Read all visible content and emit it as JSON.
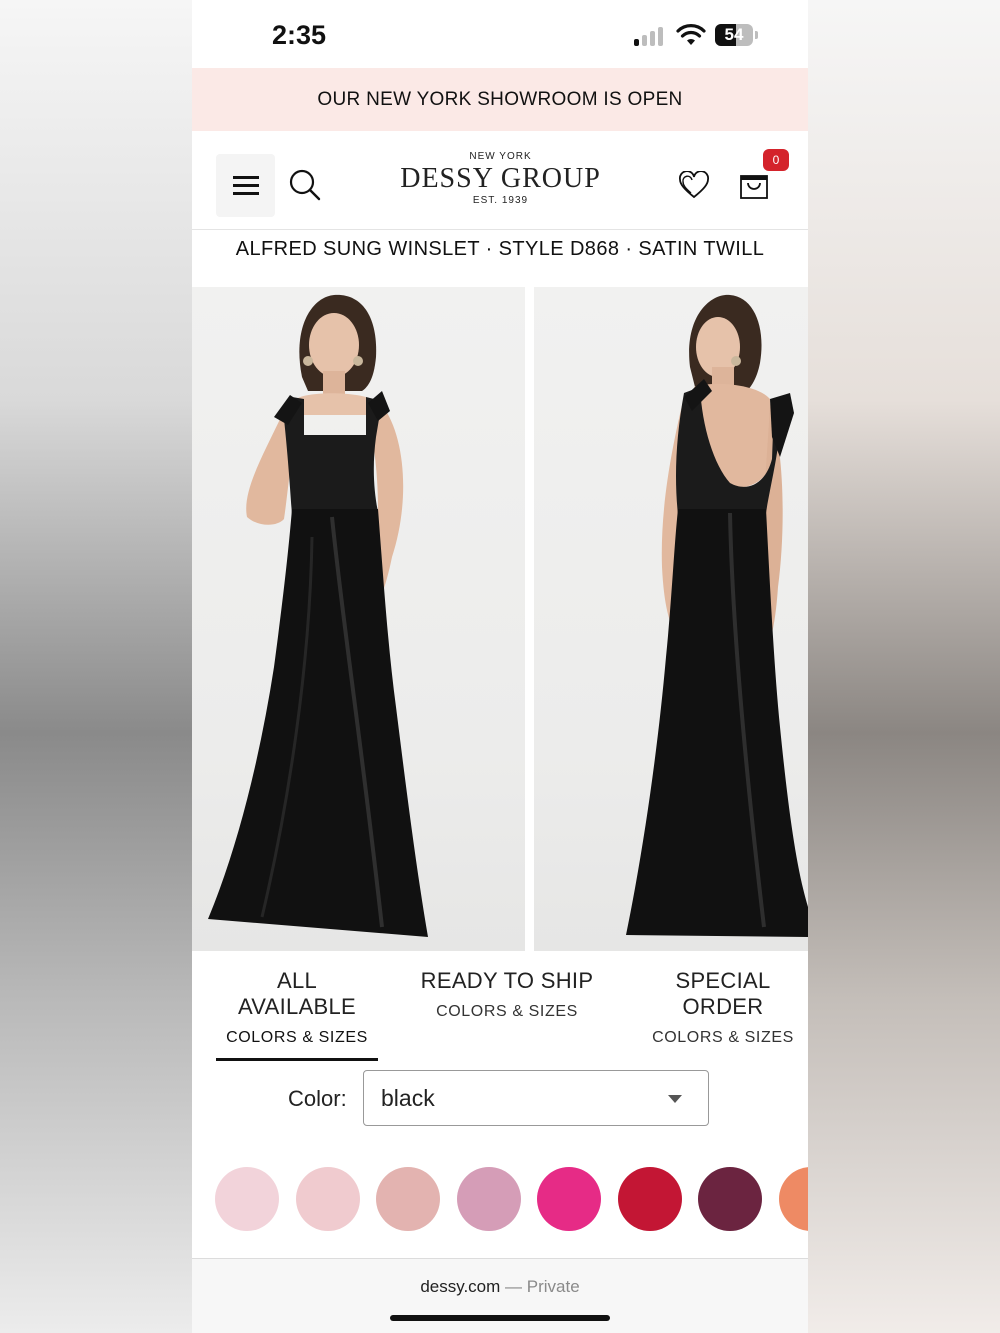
{
  "status_bar": {
    "time": "2:35",
    "battery": "54",
    "battery_level": 0.54
  },
  "promo": {
    "text": "OUR NEW YORK SHOWROOM IS OPEN"
  },
  "header": {
    "logo_top": "NEW YORK",
    "logo_main": "DESSY GROUP",
    "logo_bottom": "EST. 1939",
    "cart_count": "0",
    "icons": [
      "menu-icon",
      "search-icon",
      "heart-icon",
      "shopping-bag-icon"
    ]
  },
  "product": {
    "title": "ALFRED SUNG WINSLET · STYLE D868 · SATIN TWILL"
  },
  "tabs": [
    {
      "title": "ALL AVAILABLE",
      "subtitle": "COLORS & SIZES",
      "active": true
    },
    {
      "title": "READY TO SHIP",
      "subtitle": "COLORS & SIZES",
      "active": false
    },
    {
      "title": "SPECIAL ORDER",
      "subtitle": "COLORS & SIZES",
      "active": false
    }
  ],
  "color_selector": {
    "label": "Color:",
    "value": "black"
  },
  "swatches": [
    "#f2d3da",
    "#f0cbcf",
    "#e3b3b0",
    "#d59db7",
    "#e62b86",
    "#c31634",
    "#6b2440",
    "#ee8a64"
  ],
  "browser": {
    "domain": "dessy.com",
    "suffix": "— Private"
  }
}
